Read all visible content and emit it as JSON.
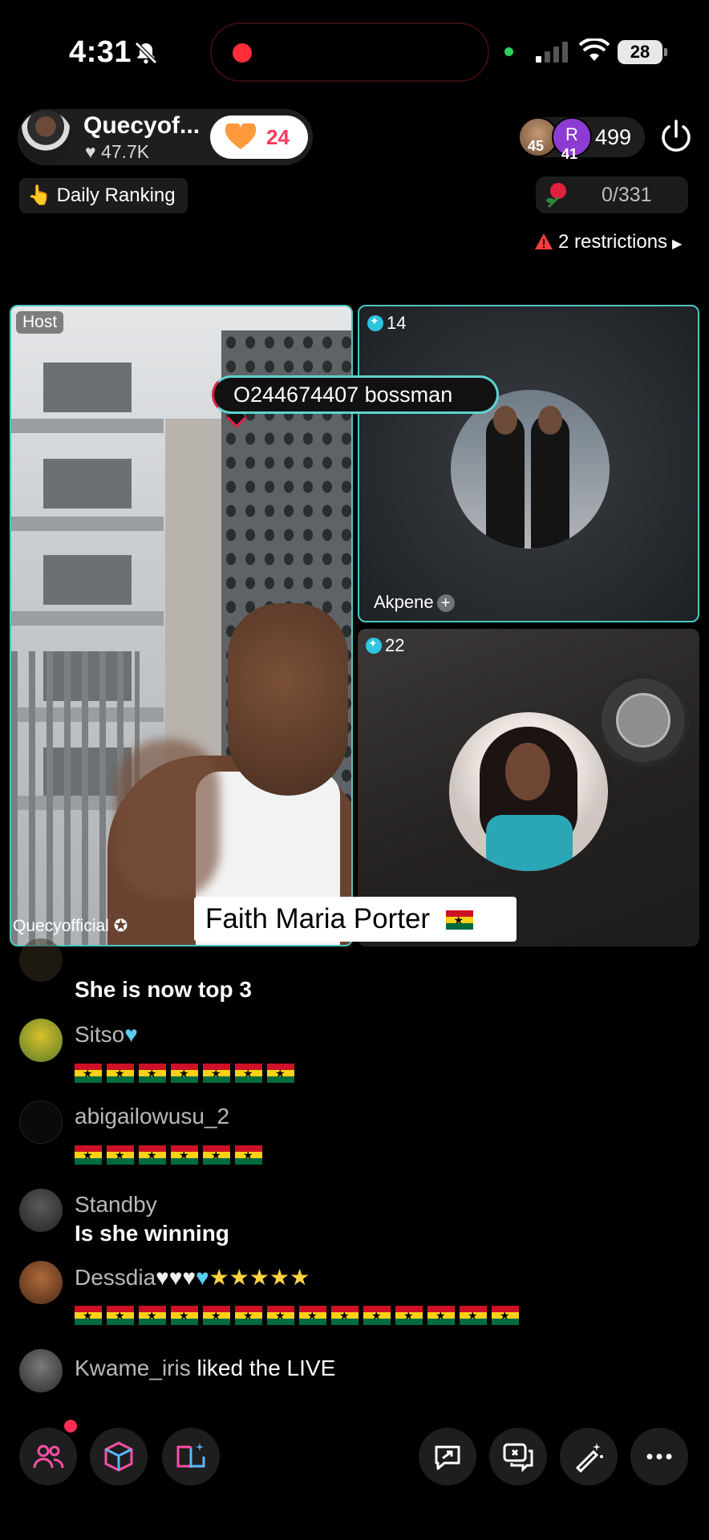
{
  "status_bar": {
    "time": "4:31",
    "battery": "28"
  },
  "host": {
    "name": "Quecyof...",
    "likes": "47.7K",
    "like_count": "24",
    "tile_label": "Host",
    "display_name": "Quecyofficial"
  },
  "viewers": {
    "badge1": "45",
    "badge2": "41",
    "avatar2_letter": "R",
    "count": "499"
  },
  "daily_ranking": "Daily Ranking",
  "rose": {
    "progress": "0/331"
  },
  "restrictions": "2 restrictions",
  "pinned_comment": "O244674407 bossman",
  "guests": [
    {
      "count": "14",
      "name": "Akpene"
    },
    {
      "count": "22"
    }
  ],
  "name_banner": "Faith Maria Porter",
  "comments": [
    {
      "text": "She is now top 3"
    },
    {
      "user": "Sitso",
      "flags": 7
    },
    {
      "user": "abigailowusu_2",
      "flags": 6
    },
    {
      "user": "Standby",
      "text": "Is she winning"
    },
    {
      "user": "Dessdia",
      "flags": 14
    },
    {
      "user": "Kwame_iris",
      "text": "liked the LIVE"
    }
  ],
  "icons": [
    "bell-off-icon",
    "signal-icon",
    "wifi-icon",
    "battery-icon",
    "heart-icon",
    "power-icon",
    "rose-icon",
    "warning-icon",
    "guests-icon",
    "box-icon",
    "book-icon",
    "share-icon",
    "chat-icon",
    "magic-wand-icon",
    "more-icon"
  ],
  "colors": {
    "accent": "#4ec5c1",
    "like": "#ff3b5c",
    "flag_red": "#ce1126",
    "flag_yellow": "#fcd116",
    "flag_green": "#006b3f"
  }
}
